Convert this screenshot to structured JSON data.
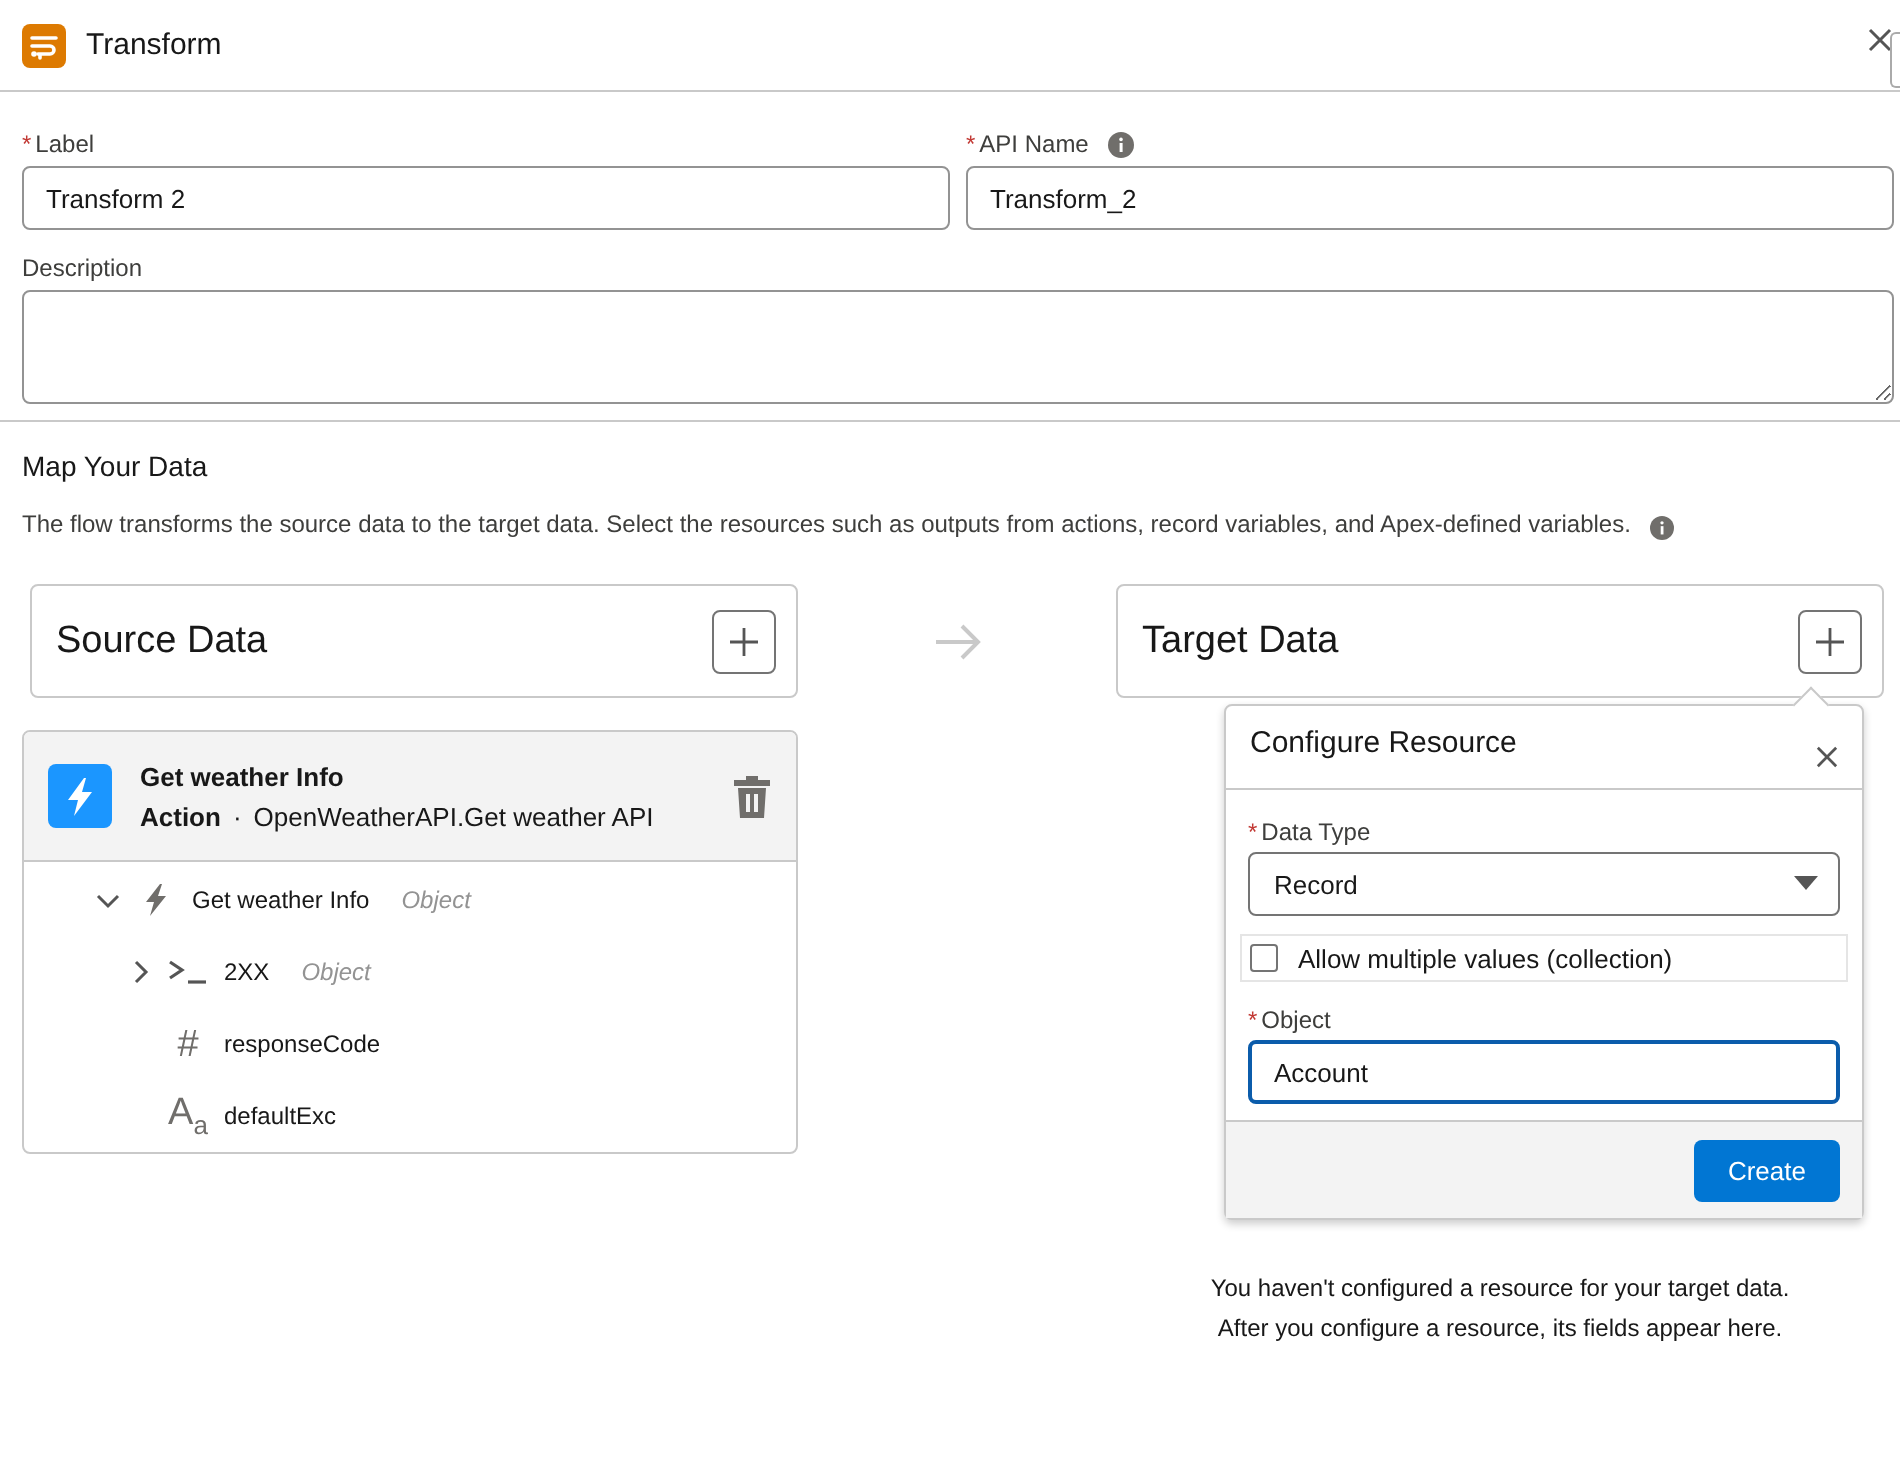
{
  "header": {
    "title": "Transform"
  },
  "fields": [
    {
      "label": "Label",
      "marker": "*",
      "value": "Transform 2",
      "kind": "input",
      "info": false
    },
    {
      "label": "API Name",
      "marker": "*",
      "value": "Transform_2",
      "kind": "input",
      "info": true
    },
    {
      "label": "Description",
      "kind": "textarea",
      "info": false
    }
  ],
  "map": {
    "title": "Map Your Data",
    "description": "The flow transforms the source data to the target data. Select the resources such as outputs from actions, record variables, and Apex-defined variables.",
    "source": {
      "title": "Source Data"
    },
    "target": {
      "title": "Target Data"
    },
    "resource": {
      "name": "Get weather Info",
      "type": "Action",
      "separator": "·",
      "api": "OpenWeatherAPI.Get weather API",
      "tree": [
        {
          "name": "Get weather Info",
          "type": "Object",
          "kind": "action",
          "expanded": true,
          "children": [
            {
              "name": "2XX",
              "type": "Object",
              "kind": "apex",
              "expanded": false
            },
            {
              "name": "responseCode",
              "kind": "number",
              "glyph": "#"
            },
            {
              "name": "defaultExc",
              "kind": "text",
              "glyph": "A$_{a}$"
            }
          ]
        }
      ]
    },
    "empty_state": [
      "You haven't configured a resource for your target data.",
      "After you configure a resource, its fields appear here."
    ]
  },
  "popover": {
    "title": "Configure Resource",
    "data_type": {
      "label": "Data Type",
      "marker": "*",
      "value": "Record"
    },
    "collection": {
      "label": "Allow multiple values (collection)",
      "checked": false
    },
    "object": {
      "label": "Object",
      "marker": "*",
      "value": "Account",
      "focused": true
    },
    "button": "Create"
  }
}
